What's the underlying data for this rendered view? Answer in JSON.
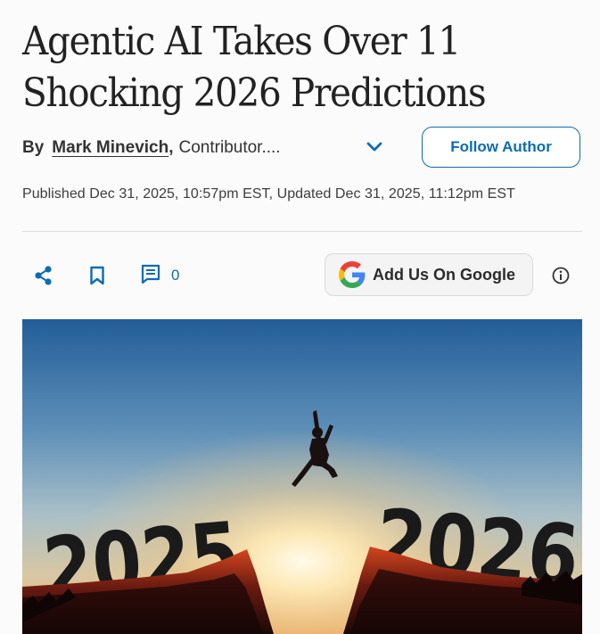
{
  "article": {
    "title": "Agentic AI Takes Over 11 Shocking 2026 Predictions",
    "byline": {
      "prefix": "By",
      "author": "Mark Minevich",
      "separator": ",",
      "role": "Contributor...."
    },
    "follow_button_label": "Follow Author",
    "dates": "Published Dec 31, 2025, 10:57pm EST, Updated Dec 31, 2025, 11:12pm EST"
  },
  "toolbar": {
    "share_icon": "share-icon",
    "bookmark_icon": "bookmark-icon",
    "comment_icon": "comment-icon",
    "comment_count": "0",
    "google_button_label": "Add Us On Google",
    "info_icon": "info-icon"
  },
  "hero_image": {
    "left_number": "2025",
    "right_number": "2026"
  },
  "colors": {
    "accent": "#0c6bb4",
    "text": "#333333",
    "background": "#fbfbfb"
  }
}
